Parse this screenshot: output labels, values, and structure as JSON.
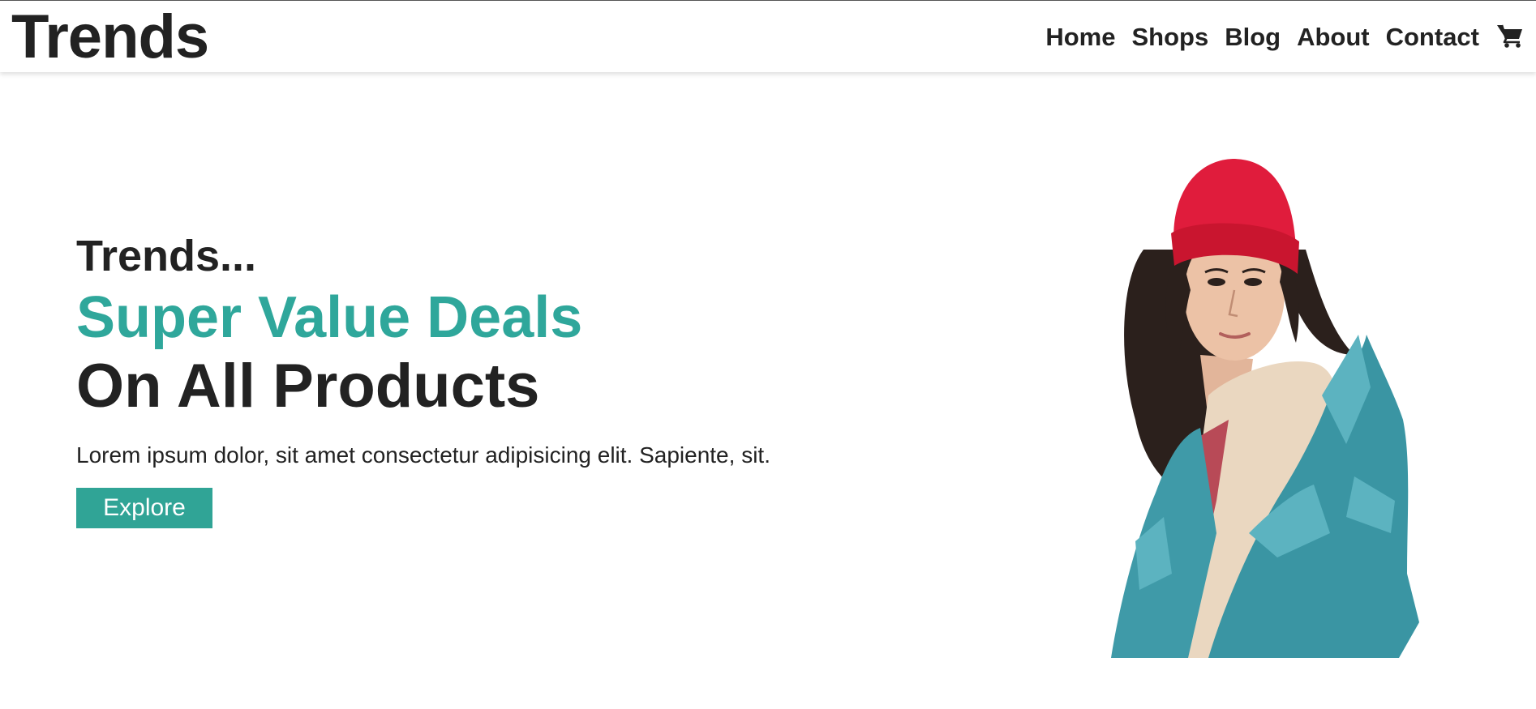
{
  "header": {
    "brand": "Trends",
    "nav": [
      {
        "label": "Home"
      },
      {
        "label": "Shops"
      },
      {
        "label": "Blog"
      },
      {
        "label": "About"
      },
      {
        "label": "Contact"
      }
    ],
    "cart_icon": "shopping-cart-icon"
  },
  "hero": {
    "pre_title": "Trends...",
    "title": "Super Value Deals",
    "subtitle": "On All Products",
    "description": "Lorem ipsum dolor, sit amet consectetur adipisicing elit. Sapiente, sit.",
    "button_label": "Explore",
    "image_subject": "model-photo"
  },
  "colors": {
    "accent": "#2fa79b",
    "button": "#30a496",
    "text": "#222222",
    "beanie": "#e01c3c",
    "jacket": "#3f9aa8"
  }
}
